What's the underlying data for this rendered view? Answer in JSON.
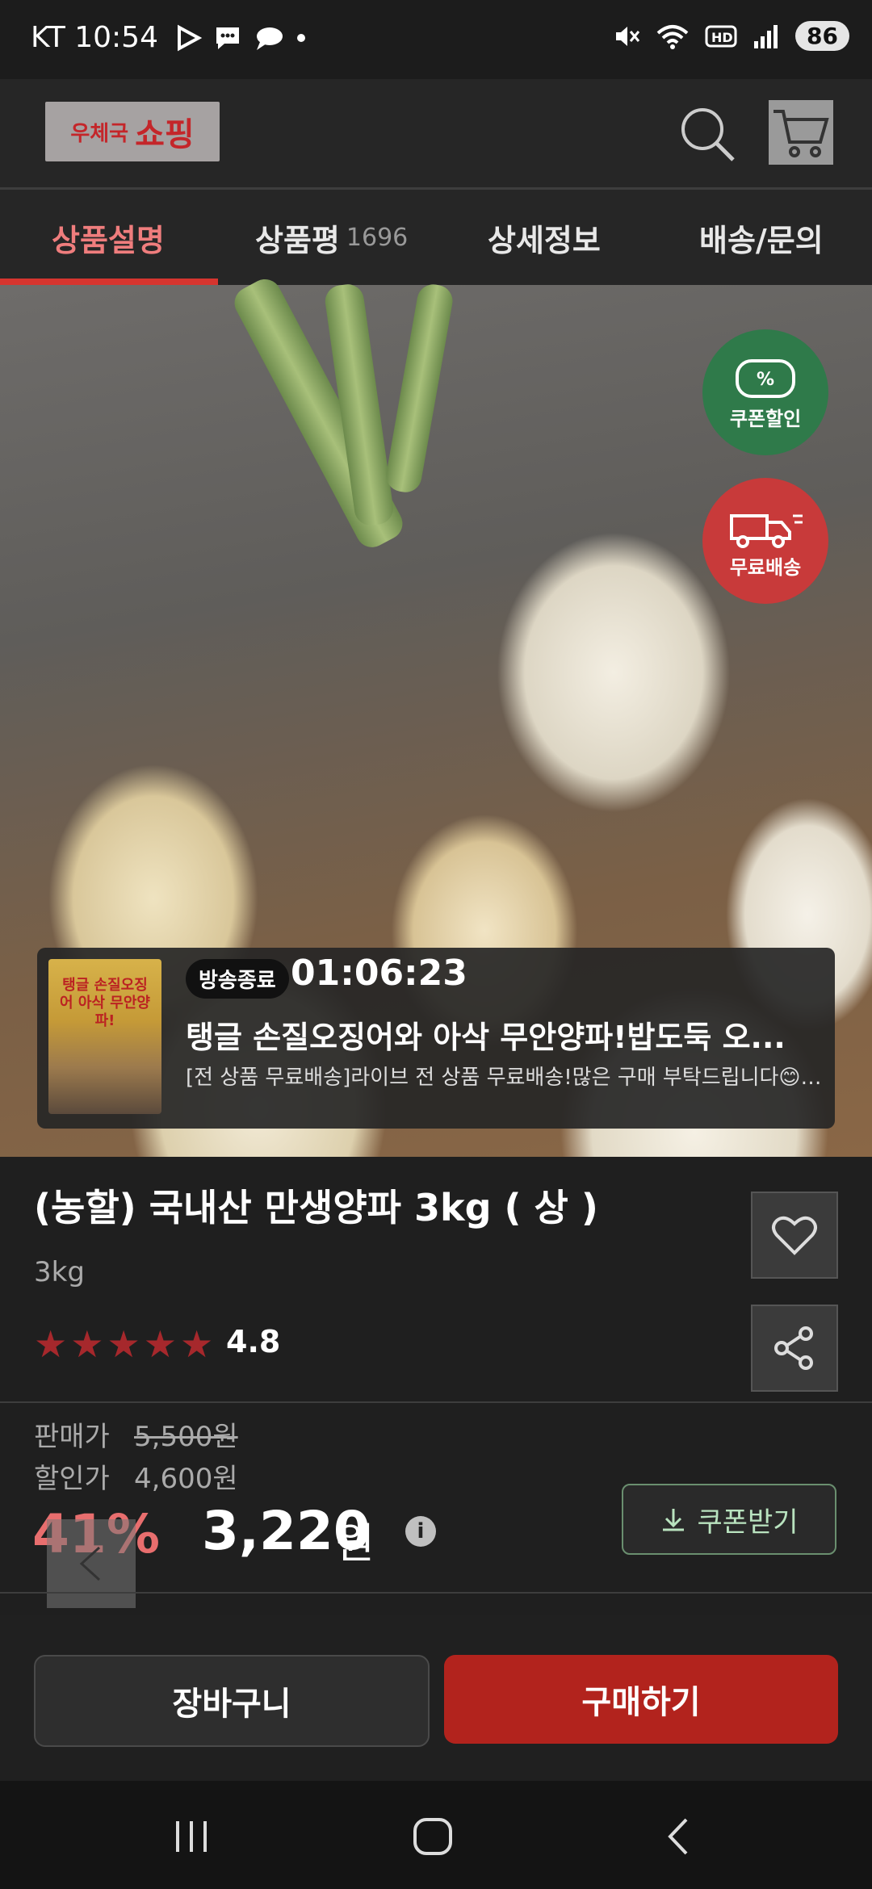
{
  "status_bar": {
    "carrier_time": "KT 10:54",
    "battery": "86"
  },
  "header": {
    "logo_small": "우체국",
    "logo_big": "쇼핑"
  },
  "tabs": [
    {
      "label": "상품설명",
      "count": ""
    },
    {
      "label": "상품평",
      "count": "1696"
    },
    {
      "label": "상세정보",
      "count": ""
    },
    {
      "label": "배송/문의",
      "count": ""
    }
  ],
  "badges": {
    "coupon": "쿠폰할인",
    "free_shipping": "무료배송"
  },
  "live": {
    "status": "방송종료",
    "time": "01:06:23",
    "title": "탱글 손질오징어와 아삭 무안양파!밥도둑 오...",
    "subtitle": "[전 상품 무료배송]라이브 전 상품 무료배송!많은 구매 부탁드립니다😊[최대...",
    "thumb_text": "탱글 손질오징어 아삭 무안양파!"
  },
  "product": {
    "title": "(농할) 국내산 만생양파 3kg ( 상 )",
    "weight": "3kg",
    "rating": "4.8"
  },
  "price": {
    "sale_label": "판매가",
    "sale_value": "5,500원",
    "discount_label": "할인가",
    "discount_value": "4,600원",
    "discount_rate": "41%",
    "final_price": "3,220",
    "final_unit": "원",
    "info": "i",
    "coupon_button": "쿠폰받기"
  },
  "actions": {
    "cart": "장바구니",
    "buy": "구매하기"
  },
  "colors": {
    "accent_red": "#b2231d",
    "tab_active": "#ef7d7d",
    "star": "#a6282c",
    "coupon_green": "#2f7a4a"
  }
}
